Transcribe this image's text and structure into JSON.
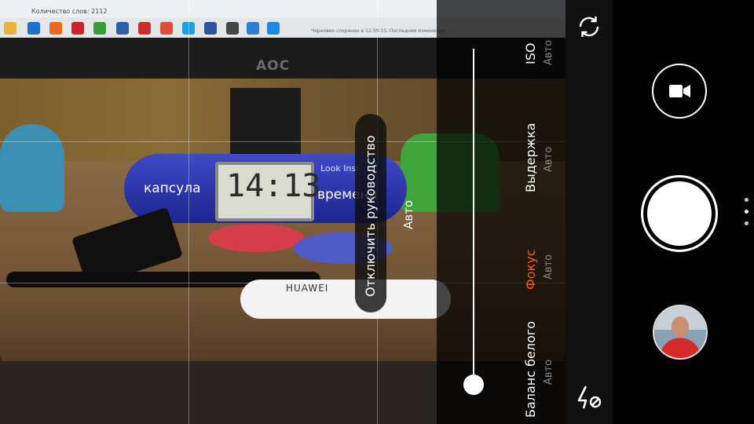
{
  "viewfinder": {
    "monitor": {
      "word_count": "Количество слов: 2112",
      "doc_status": "Черновик сохранен в 12:59:15. Последнее изменение: ..."
    },
    "monitor_brand": "AOC",
    "clock_time": "14:13",
    "capsule_left_text": "капсула",
    "capsule_right_text": "времени",
    "capsule_top_text": "Look Insi",
    "usb_brand": "HUAWEI",
    "taskbar_icons": [
      {
        "icon": "folder-icon",
        "color": "#e8b33a"
      },
      {
        "icon": "edge-icon",
        "color": "#1f6fd0"
      },
      {
        "icon": "firefox-icon",
        "color": "#e86a1f"
      },
      {
        "icon": "opera-icon",
        "color": "#d0202a"
      },
      {
        "icon": "chrome-icon",
        "color": "#3a9b3a"
      },
      {
        "icon": "app-icon",
        "color": "#2b5fa8"
      },
      {
        "icon": "mail-icon",
        "color": "#c9302c"
      },
      {
        "icon": "chrome-icon",
        "color": "#dd4b39"
      },
      {
        "icon": "skype-icon",
        "color": "#1ea1e0"
      },
      {
        "icon": "word-icon",
        "color": "#2b579a"
      },
      {
        "icon": "app-icon",
        "color": "#444444"
      },
      {
        "icon": "app-icon",
        "color": "#2d7dd2"
      },
      {
        "icon": "app-icon",
        "color": "#1e88e5"
      }
    ]
  },
  "manual_controls": {
    "guide_button_label": "Отключить руководство",
    "slider_value": "Авто",
    "slider_level": 1.0,
    "params": {
      "iso": {
        "name": "ISO",
        "value": "Авто"
      },
      "exposure": {
        "name": "Выдержка",
        "value": "Авто"
      },
      "focus": {
        "name": "Фокус",
        "value": "Авто",
        "active": true
      },
      "white_balance": {
        "name": "Баланс белого",
        "value": "Авто"
      }
    },
    "active_color": "#ff5b16"
  },
  "controls": {
    "switch_camera_icon": "switch-camera-icon",
    "flash_icon": "flash-off-icon",
    "video_icon": "video-camera-icon",
    "page_dots": [
      "#cccccc",
      "#ffffff",
      "#cccccc"
    ]
  }
}
